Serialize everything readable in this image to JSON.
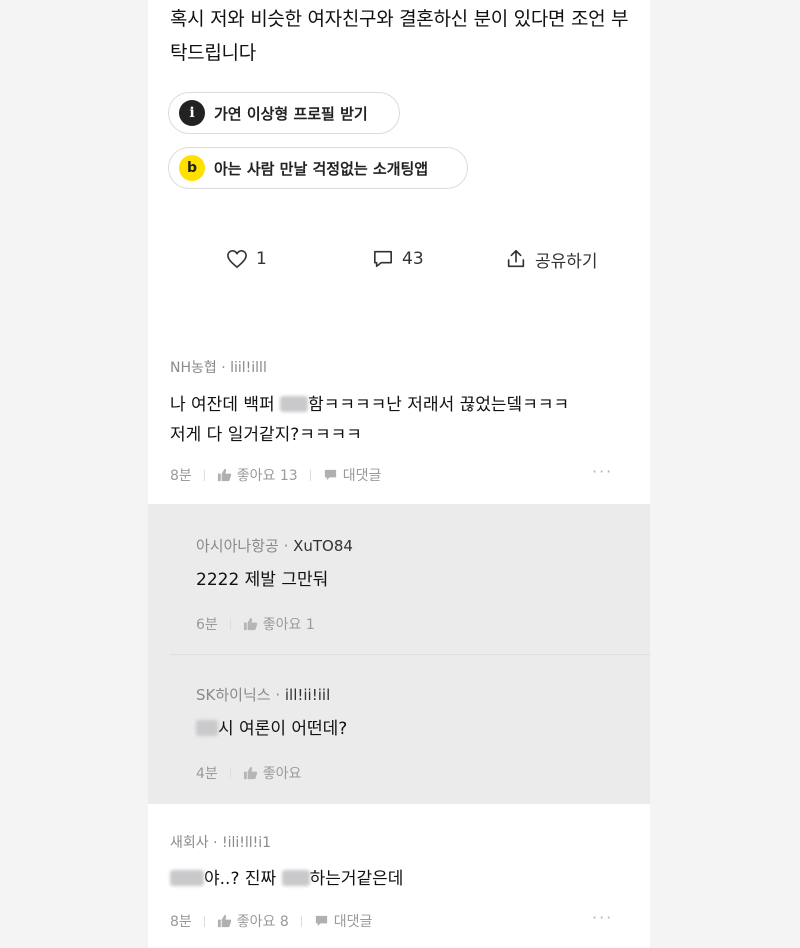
{
  "post": {
    "text": "혹시 저와 비슷한 여자친구와 결혼하신 분이 있다면 조언 부탁드립니다"
  },
  "promos": [
    {
      "icon": "i",
      "label": "가연 이상형 프로필 받기"
    },
    {
      "icon": "b",
      "label": "아는 사람 만날 걱정없는 소개팅앱"
    }
  ],
  "actions": {
    "likes": "1",
    "comments": "43",
    "share": "공유하기"
  },
  "comments": [
    {
      "author": "NH농협 · liil!illl",
      "body_1": "나 여잔데 백퍼 ",
      "body_2": "함ㅋㅋㅋㅋ난 저래서 끊었는뎈ㅋㅋㅋ",
      "body_3": "저게 다 일거같지?ㅋㅋㅋㅋ",
      "time": "8분",
      "likes": "좋아요 13",
      "reply": "대댓글"
    },
    {
      "author": "새회사 · !ili!ll!i1",
      "body_1": "",
      "body_2": "야..? 진짜 ",
      "body_3": "하는거같은데",
      "time": "8분",
      "likes": "좋아요 8",
      "reply": "대댓글"
    }
  ],
  "replies": [
    {
      "company": "아시아나항공 · ",
      "nick": "XuTO84",
      "body": "2222 제발 그만둬",
      "time": "6분",
      "likes": "좋아요 1"
    },
    {
      "company": "SK하이닉스 · ",
      "nick": "ill!ii!iil",
      "body": "시 여론이 어떤데?",
      "time": "4분",
      "likes": "좋아요"
    }
  ],
  "more": "···",
  "colors": {
    "promo_yellow": "#ffe100",
    "reply_bg": "#ebebeb"
  }
}
